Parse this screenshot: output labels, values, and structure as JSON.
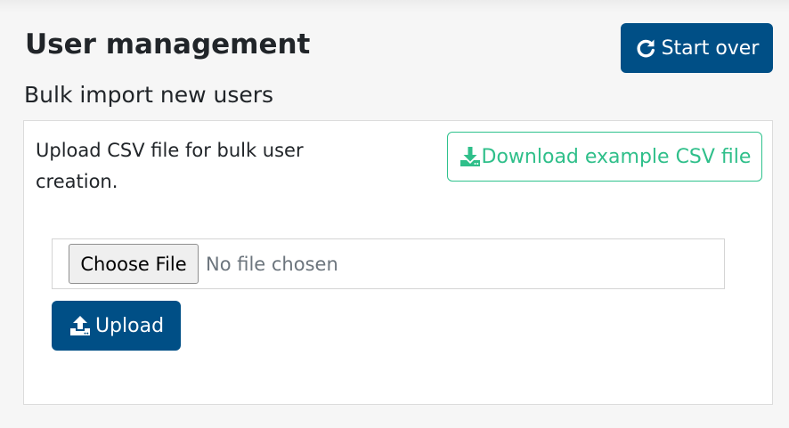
{
  "header": {
    "title": "User management",
    "start_over_label": "Start over",
    "start_over_icon": "redo-icon"
  },
  "section": {
    "subtitle": "Bulk import new users"
  },
  "card": {
    "description": "Upload CSV file for bulk user creation.",
    "download_label": "Download example CSV file",
    "download_icon": "download-icon",
    "file_input": {
      "button_label": "Choose File",
      "status_text": "No file chosen"
    },
    "upload_label": "Upload",
    "upload_icon": "upload-icon"
  },
  "colors": {
    "primary": "#004f86",
    "success": "#2fbf8a",
    "background": "#f6f6f6",
    "card_background": "#ffffff"
  }
}
